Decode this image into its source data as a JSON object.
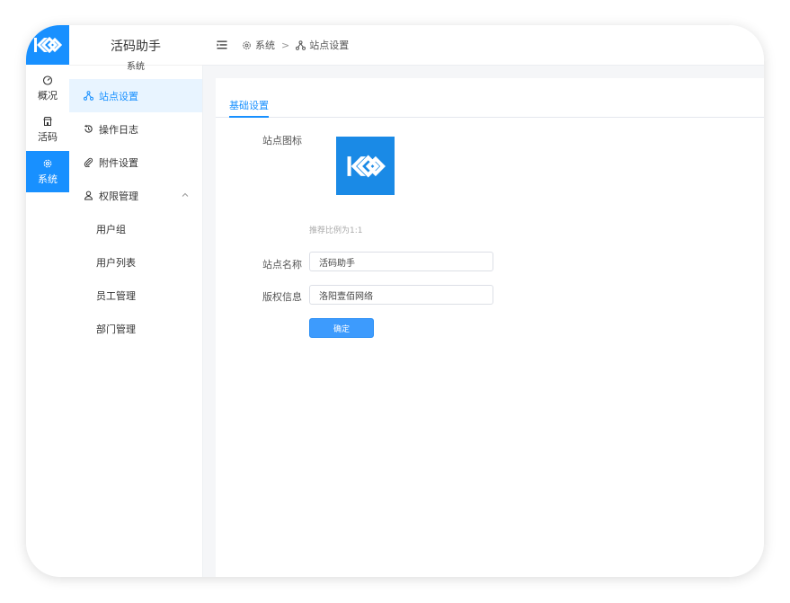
{
  "app": {
    "title": "活码助手",
    "section_title": "系统"
  },
  "rail": {
    "items": [
      {
        "label": "概况",
        "icon": "dashboard-icon"
      },
      {
        "label": "活码",
        "icon": "store-icon"
      },
      {
        "label": "系统",
        "icon": "gear-icon",
        "active": true
      }
    ]
  },
  "submenu": {
    "items": [
      {
        "label": "站点设置",
        "icon": "sitemap-icon",
        "active": true
      },
      {
        "label": "操作日志",
        "icon": "history-icon"
      },
      {
        "label": "附件设置",
        "icon": "paperclip-icon"
      },
      {
        "label": "权限管理",
        "icon": "user-icon",
        "expanded": true
      }
    ],
    "children": [
      {
        "label": "用户组"
      },
      {
        "label": "用户列表"
      },
      {
        "label": "员工管理"
      },
      {
        "label": "部门管理"
      }
    ]
  },
  "breadcrumb": {
    "root": "系统",
    "separator": ">",
    "current": "站点设置"
  },
  "tabs": {
    "basic": "基础设置"
  },
  "form": {
    "icon_label": "站点图标",
    "icon_hint": "推荐比例为1:1",
    "name_label": "站点名称",
    "name_value": "活码助手",
    "copyright_label": "版权信息",
    "copyright_value": "洛阳壹佰网络",
    "submit_label": "确定"
  },
  "colors": {
    "accent": "#1890ff",
    "logo_bg": "#1a8ae6"
  }
}
